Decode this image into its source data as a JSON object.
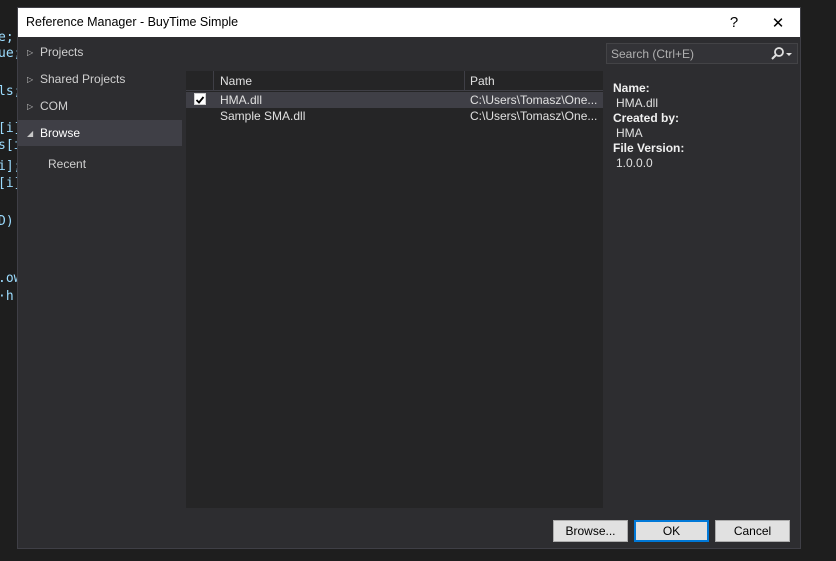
{
  "background_code": {
    "lines": [
      "e;",
      "ue;",
      "ls;",
      "[i]",
      "s[i",
      "i];",
      "[i]",
      "D)",
      ".ow",
      "·h"
    ]
  },
  "dialog": {
    "title": "Reference Manager - BuyTime Simple",
    "help_label": "?",
    "close_label": "✕"
  },
  "nav": {
    "items": [
      {
        "label": "Projects",
        "arrow": "▷",
        "active": false
      },
      {
        "label": "Shared Projects",
        "arrow": "▷",
        "active": false
      },
      {
        "label": "COM",
        "arrow": "▷",
        "active": false
      },
      {
        "label": "Browse",
        "arrow": "◢",
        "active": true
      }
    ],
    "sub_items": [
      {
        "label": "Recent"
      }
    ]
  },
  "search": {
    "placeholder": "Search (Ctrl+E)",
    "icon": "search-icon",
    "dropdown_icon": "chevron-down-icon"
  },
  "grid": {
    "columns": [
      "Name",
      "Path"
    ],
    "rows": [
      {
        "checked": true,
        "name": "HMA.dll",
        "path": "C:\\Users\\Tomasz\\One...",
        "selected": true
      },
      {
        "checked": false,
        "name": "Sample SMA.dll",
        "path": "C:\\Users\\Tomasz\\One...",
        "selected": false
      }
    ]
  },
  "details": {
    "name_label": "Name:",
    "name_value": "HMA.dll",
    "created_label": "Created by:",
    "created_value": "HMA",
    "version_label": "File Version:",
    "version_value": "1.0.0.0"
  },
  "footer": {
    "browse_label": "Browse...",
    "ok_label": "OK",
    "cancel_label": "Cancel"
  },
  "colors": {
    "dialog_bg": "#2d2d30",
    "grid_bg": "#252526",
    "selected_row": "#3f3f46",
    "accent": "#0078d7"
  }
}
